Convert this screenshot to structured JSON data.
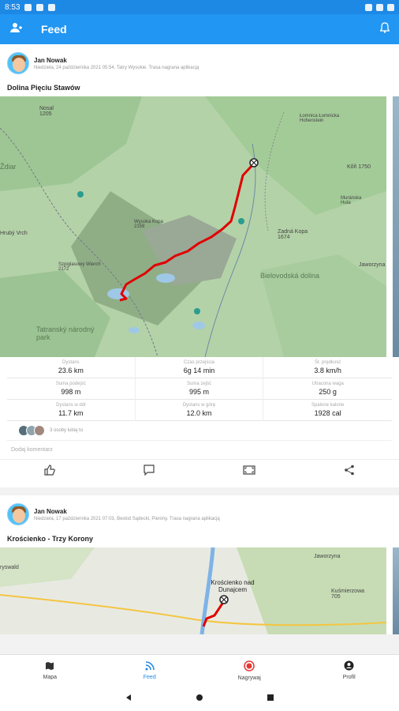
{
  "status": {
    "time": "8:53"
  },
  "appbar": {
    "title": "Feed",
    "friends_icon": "people-icon",
    "bell_icon": "bell-icon"
  },
  "posts": [
    {
      "author": "Jan Nowak",
      "meta": "Niedziela, 24 października 2021 05:54, Tatry Wysokie. Trasa nagrana aplikacją",
      "route_title": "Dolina Pięciu Stawów",
      "map_labels": [
        "Nosal 1205",
        "Łomnica Łomnicka Hohenstein",
        "Kôň 1750",
        "Muránska Huta",
        "Zadná Kopa 1674",
        "Jaworzyna",
        "Bielovodská dolina",
        "Wysoka Kopa 2159",
        "Szpiglasowy Wierch 2172",
        "Tatranský národný park",
        "Hrubý Vrch",
        "Ždiar"
      ],
      "stats": [
        {
          "label": "Dystans",
          "value": "23.6 km"
        },
        {
          "label": "Czas przejścia",
          "value": "6g 14 min"
        },
        {
          "label": "Śr. prędkość",
          "value": "3.8 km/h"
        },
        {
          "label": "Suma podejść",
          "value": "998 m"
        },
        {
          "label": "Suma zejść",
          "value": "995 m"
        },
        {
          "label": "Utracona waga",
          "value": "250 g"
        },
        {
          "label": "Dystans w dół",
          "value": "11.7 km"
        },
        {
          "label": "Dystans w górę",
          "value": "12.0 km"
        },
        {
          "label": "Spalone kalorie",
          "value": "1928 cal"
        }
      ],
      "likes_text": "3 osoby lubią to",
      "comment_placeholder": "Dodaj komentarz"
    },
    {
      "author": "Jan Nowak",
      "meta": "Niedziela, 17 października 2021 07:03, Beskid Sądecki, Pieniny. Trasa nagrana aplikacją",
      "route_title": "Krościenko - Trzy Korony",
      "map_labels": [
        "Jaworzyna",
        "Krościenko nad Dunajcem",
        "Kuśmierzowa 705",
        "ryswald"
      ]
    }
  ],
  "bottom_nav": [
    {
      "label": "Mapa",
      "icon": "map-icon"
    },
    {
      "label": "Feed",
      "icon": "rss-icon"
    },
    {
      "label": "Nagrywaj",
      "icon": "record-icon"
    },
    {
      "label": "Profil",
      "icon": "profile-icon"
    }
  ],
  "colors": {
    "primary": "#2196f3",
    "route": "#e00000",
    "map_green": "#a8c9a0"
  }
}
